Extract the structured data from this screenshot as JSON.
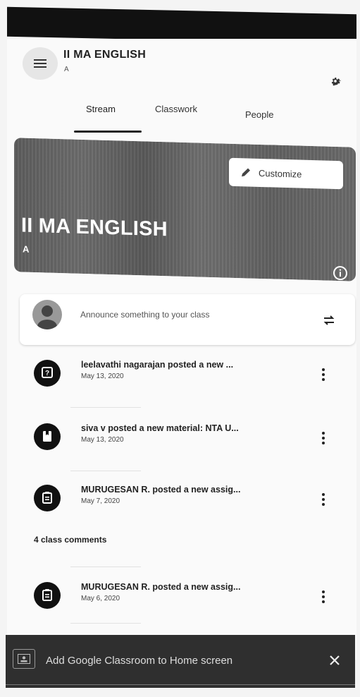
{
  "header": {
    "title": "II MA ENGLISH",
    "subtitle": "A",
    "menu_icon": "hamburger-icon",
    "settings_icon": "gear-icon"
  },
  "tabs": [
    {
      "label": "Stream",
      "active": true
    },
    {
      "label": "Classwork",
      "active": false
    },
    {
      "label": "People",
      "active": false
    }
  ],
  "banner": {
    "title": "II MA ENGLISH",
    "subtitle": "A",
    "customize_label": "Customize",
    "customize_icon": "pencil-icon",
    "info_icon": "info-icon"
  },
  "announce": {
    "placeholder": "Announce something to your class",
    "avatar_icon": "person-avatar-icon",
    "repost_icon": "repost-icon"
  },
  "feed": [
    {
      "icon": "question-icon",
      "title": "leelavathi nagarajan posted a new ...",
      "date": "May 13, 2020"
    },
    {
      "icon": "material-icon",
      "title": "siva v posted a new material: NTA U...",
      "date": "May 13, 2020"
    },
    {
      "icon": "assignment-icon",
      "title": "MURUGESAN R. posted a new assig...",
      "date": "May 7, 2020"
    },
    {
      "icon": "assignment-icon",
      "title": "MURUGESAN R. posted a new assig...",
      "date": "May 6, 2020"
    }
  ],
  "class_comments": "4 class comments",
  "snackbar": {
    "text": "Add Google Classroom to Home screen",
    "close_icon": "close-icon"
  },
  "colors": {
    "banner": "#666666",
    "text": "#222222",
    "snackbar": "#2f2f2f"
  }
}
